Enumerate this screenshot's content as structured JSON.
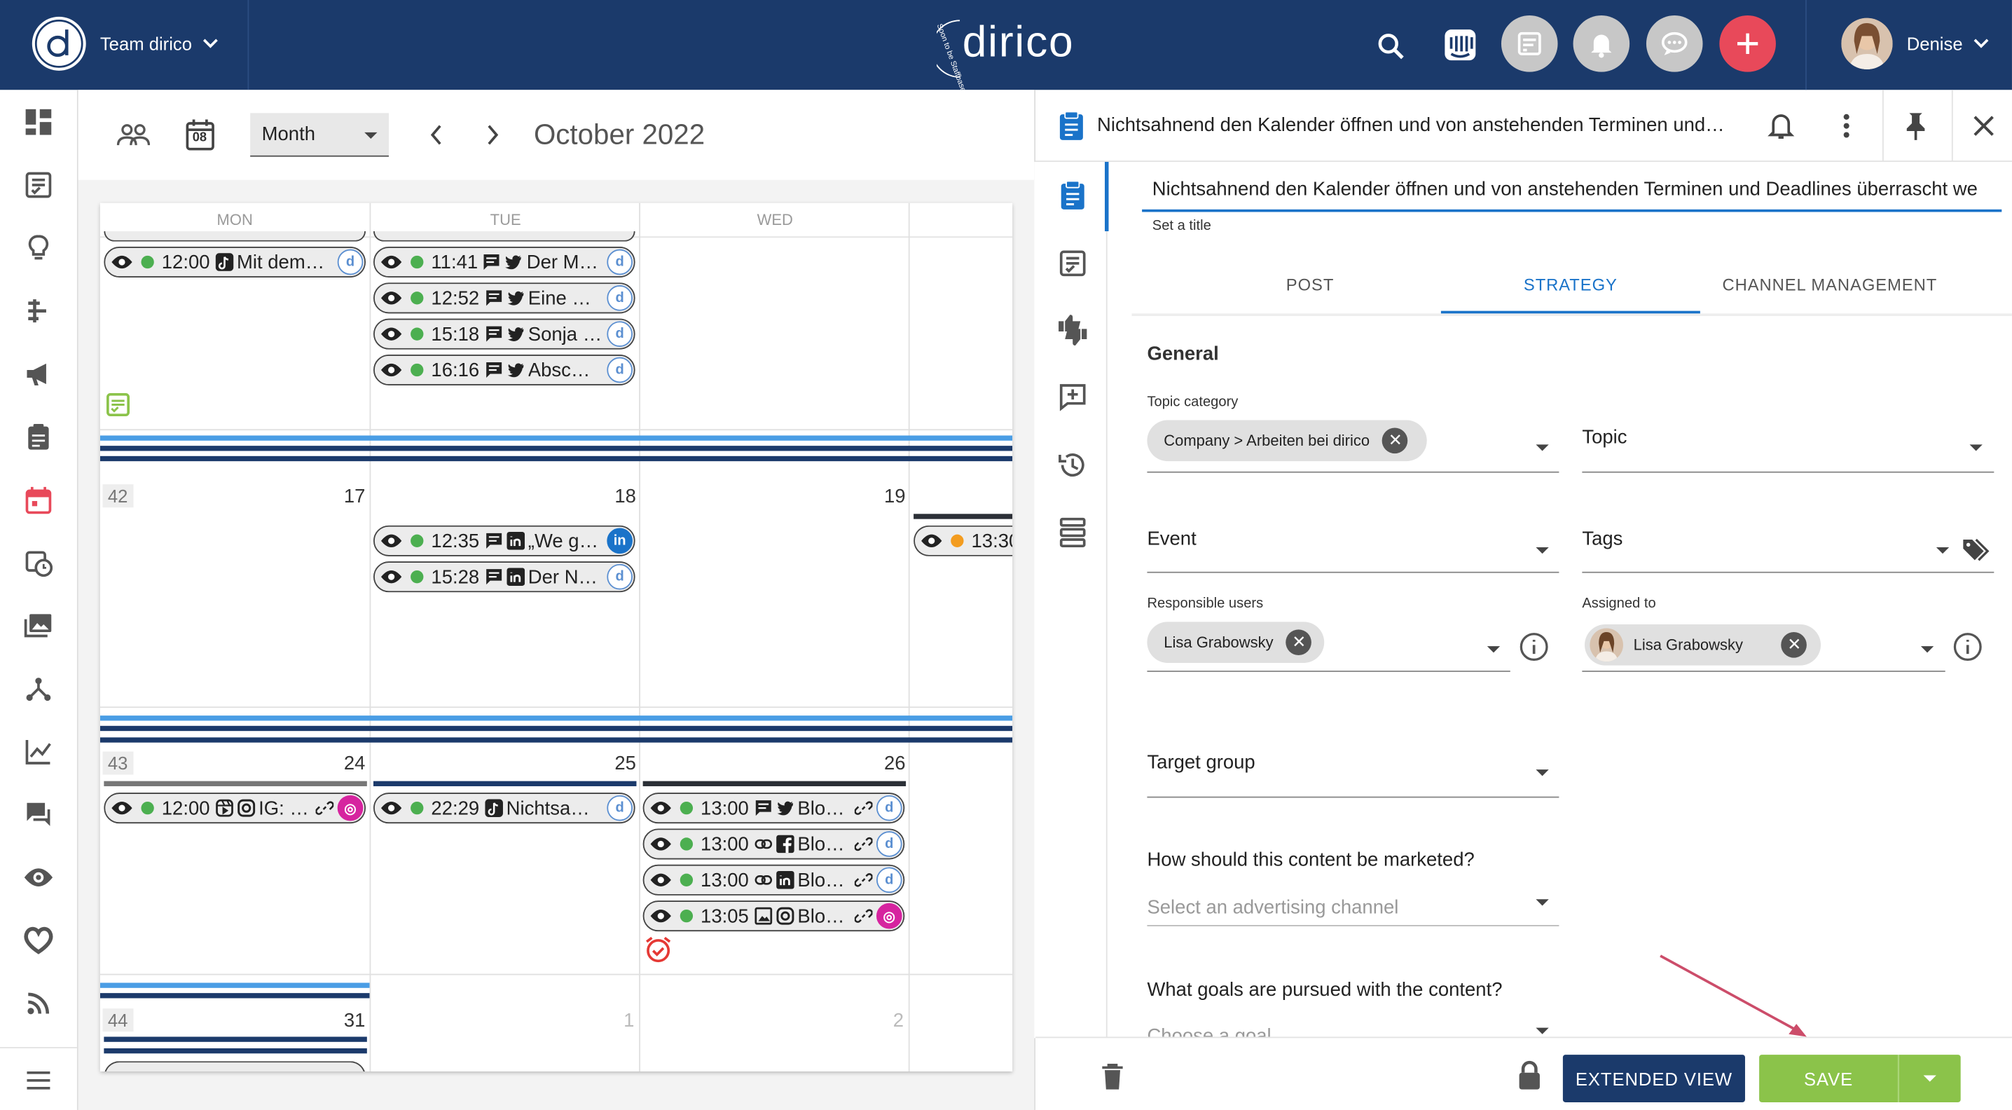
{
  "header": {
    "team_label": "Team dirico",
    "brand": "dirico",
    "brand_sub": "Soon to be Staffbase",
    "user_name": "Denise",
    "icons": [
      "search-icon",
      "intercom-icon",
      "tasks-icon",
      "bell-icon",
      "chat-icon",
      "plus-icon"
    ]
  },
  "sidebar": {
    "icons": [
      "dashboard-icon",
      "checklist-icon",
      "idea-icon",
      "timeline-icon",
      "megaphone-icon",
      "clipboard-icon",
      "calendar-icon",
      "schedule-icon",
      "media-icon",
      "network-icon",
      "chart-icon",
      "comments-icon",
      "eye-icon",
      "heart-icon",
      "rss-icon",
      "menu-icon"
    ]
  },
  "calendar": {
    "view_select": "Month",
    "today_day": "08",
    "period_title": "October 2022",
    "day_headers": [
      "MON",
      "TUE",
      "WED"
    ],
    "weeks": [
      {
        "week": "",
        "days": [
          "",
          "",
          ""
        ]
      },
      {
        "week": "42",
        "days": [
          "17",
          "18",
          "19"
        ]
      },
      {
        "week": "43",
        "days": [
          "24",
          "25",
          "26"
        ]
      },
      {
        "week": "44",
        "days": [
          "31",
          "1",
          "2"
        ]
      }
    ],
    "events": [
      {
        "time": "12:00",
        "text": "Mit dem…",
        "status": "green"
      },
      {
        "time": "11:41",
        "text": "Der M…",
        "status": "green"
      },
      {
        "time": "12:52",
        "text": "Eine …",
        "status": "green"
      },
      {
        "time": "15:18",
        "text": "Sonja …",
        "status": "green"
      },
      {
        "time": "16:16",
        "text": "Absc…",
        "status": "green"
      },
      {
        "time": "12:35",
        "text": "„We g…",
        "status": "green"
      },
      {
        "time": "15:28",
        "text": "Der N…",
        "status": "green"
      },
      {
        "time": "13:30",
        "text": "",
        "status": "orange"
      },
      {
        "time": "12:00",
        "text": "IG: …",
        "status": "green"
      },
      {
        "time": "22:29",
        "text": "Nichtsa…",
        "status": "green"
      },
      {
        "time": "13:00",
        "text": "Blo…",
        "status": "green"
      },
      {
        "time": "13:00",
        "text": "Blo…",
        "status": "green"
      },
      {
        "time": "13:00",
        "text": "Blo…",
        "status": "green"
      },
      {
        "time": "13:05",
        "text": "Blo…",
        "status": "green"
      }
    ]
  },
  "panel": {
    "header_title": "Nichtsahnend den Kalender öffnen und von anstehenden Terminen und…",
    "title_value": "Nichtsahnend den Kalender öffnen und von anstehenden Terminen und Deadlines überrascht we",
    "title_hint": "Set a title",
    "tabs": [
      "POST",
      "STRATEGY",
      "CHANNEL MANAGEMENT"
    ],
    "active_tab": "STRATEGY",
    "section_general": "General",
    "topic_category_label": "Topic category",
    "topic_category_chip": "Company > Arbeiten bei dirico",
    "topic_label": "Topic",
    "event_label": "Event",
    "tags_label": "Tags",
    "responsible_label": "Responsible users",
    "responsible_chip": "Lisa Grabowsky",
    "assigned_label": "Assigned to",
    "assigned_chip": "Lisa Grabowsky",
    "target_group_label": "Target group",
    "marketing_question": "How should this content be marketed?",
    "marketing_placeholder": "Select an advertising channel",
    "goals_question": "What goals are pursued with the content?",
    "goals_placeholder": "Choose a goal",
    "extended_view": "EXTENDED VIEW",
    "save": "SAVE"
  },
  "colors": {
    "navy": "#1b3a6b",
    "accent_blue": "#1a73c9",
    "save_green": "#8bc34a",
    "add_red": "#e8495a",
    "status_green": "#4caf50",
    "status_orange": "#f39c1f"
  }
}
